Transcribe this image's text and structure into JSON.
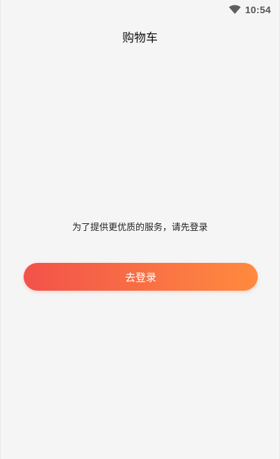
{
  "status_bar": {
    "time": "10:54",
    "wifi_icon": "wifi-icon"
  },
  "header": {
    "title": "购物车"
  },
  "main": {
    "login_prompt": "为了提供更优质的服务，请先登录",
    "login_button_label": "去登录"
  },
  "colors": {
    "background": "#f5f5f5",
    "button_gradient_start": "#f2524a",
    "button_gradient_end": "#ff8a3e",
    "button_text": "#ffffff"
  }
}
